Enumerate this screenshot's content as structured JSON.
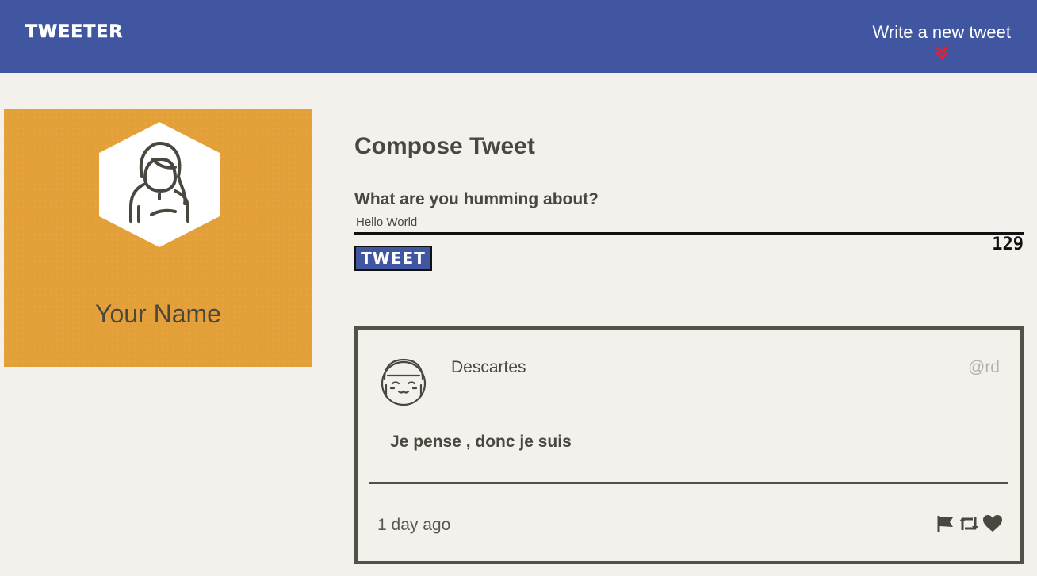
{
  "nav": {
    "brand": "TWEETER",
    "write_link": "Write a new tweet",
    "chevron_icon": "double-chevron-down-icon",
    "chevron_color": "#e8202e",
    "bg_color": "#4056a1"
  },
  "profile": {
    "name": "Your Name",
    "avatar_icon": "user-avatar-icon",
    "bg_color": "#e4a038"
  },
  "compose": {
    "title": "Compose Tweet",
    "label": "What are you humming about?",
    "input_value": "Hello World",
    "button_label": "TWEET",
    "counter": "129"
  },
  "tweet": {
    "name": "Descartes",
    "handle": "@rd",
    "text": "Je pense , donc je suis",
    "time": "1 day ago",
    "avatar_icon": "smiling-face-avatar-icon",
    "actions": [
      "flag-icon",
      "retweet-icon",
      "heart-icon"
    ]
  }
}
